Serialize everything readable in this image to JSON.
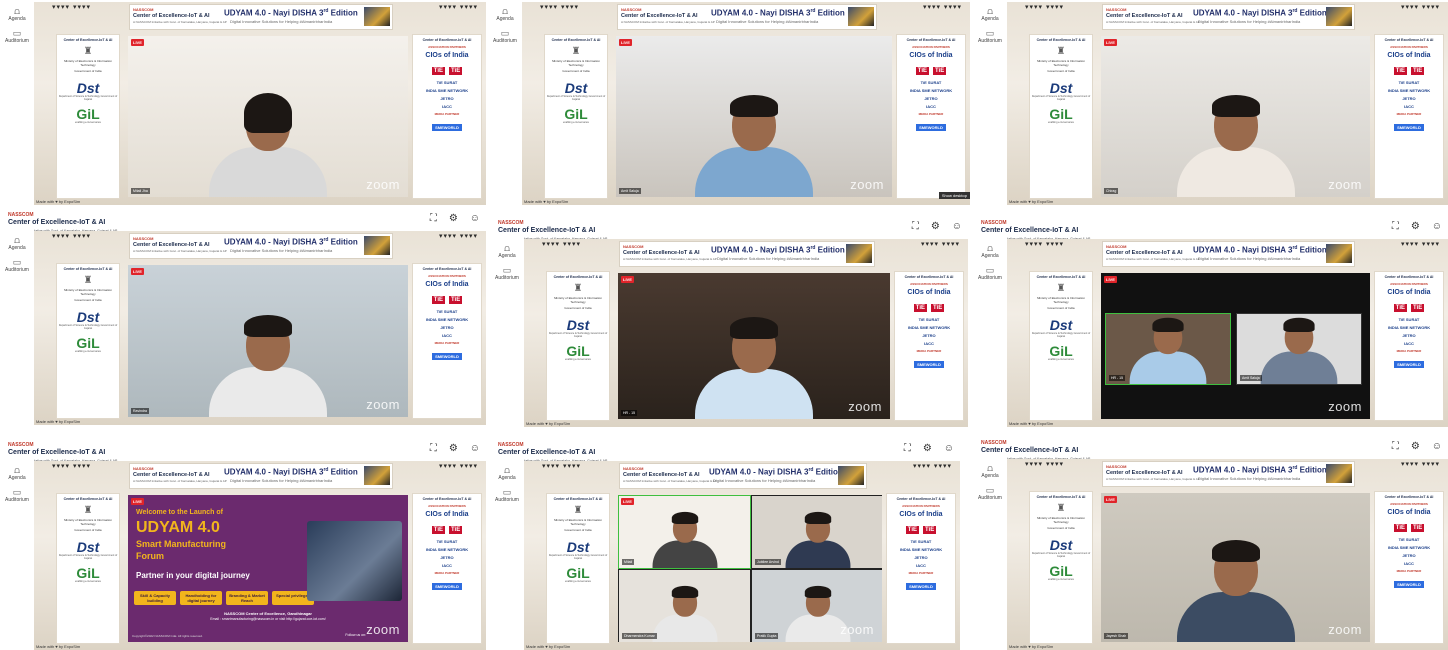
{
  "colors": {
    "brand_red": "#c0392b",
    "live_red": "#e0242a",
    "title_blue": "#23306b",
    "promo_purple": "#6b2a6e",
    "promo_yellow": "#f2b51c"
  },
  "app": {
    "brand_small": "NASSCOM",
    "brand_name": "Center of Excellence-IoT & AI",
    "brand_tag": "A NASSCOM Initiative with Govt. of Karnataka, Haryana, Gujarat & AP",
    "icons": [
      "fullscreen-icon",
      "gear-icon",
      "profile-icon"
    ]
  },
  "sidebar": {
    "items": [
      {
        "label": "Agenda",
        "icon": "podium-icon"
      },
      {
        "label": "Auditorium",
        "icon": "screen-icon"
      }
    ]
  },
  "stage": {
    "banner": {
      "nasscom": "NASSCOM",
      "coe": "Center of Excellence-IoT & AI",
      "coe_tag": "A NASSCOM Initiative with Govt. of Karnataka, Haryana, Gujarat & AP",
      "title": "UDYAM 4.0 - Nayi DISHA 3",
      "title_sup": "rd",
      "title_suffix": " Edition",
      "subtitle": "Digital Innovative Solutions for Helping #AtmanirbharIndia"
    },
    "left_panel": {
      "header": "Center of Excellence-IoT & AI",
      "ministry": "Ministry of Electronics & Information Technology",
      "ministry_sub": "Government of India",
      "dst": "Dst",
      "dst_sub": "Department of Science & Technology Government of Gujarat",
      "gil": "GiL",
      "gil_sub": "enabling e-Governance"
    },
    "right_panel": {
      "header": "Center of Excellence-IoT & AI",
      "association": "ASSOCIATION PARTNERS",
      "cios": "CIOs of India",
      "tie1": "TiE",
      "tie2": "TiE",
      "tie_surat": "TiE SURAT",
      "india_sme": "INDIA SME NETWORK",
      "jetro": "JETRO",
      "iacc": "IACC",
      "media": "MEDIA PARTNER",
      "smeworld": "SMEWORLD"
    },
    "made_with": "Made with ♥ by ExpoSim",
    "live": "LIVE",
    "zoom": "zoom",
    "show_desktop": "Show desktop"
  },
  "panels": [
    {
      "name_tag": "Mitali Jha",
      "speaker": "woman"
    },
    {
      "name_tag": "Amit Saluja",
      "speaker": "man"
    },
    {
      "name_tag": "Chirag",
      "speaker": "man"
    },
    {
      "name_tag": "Ravindra",
      "speaker": "man"
    },
    {
      "name_tag": "HR - 15",
      "speaker": "man"
    },
    {
      "name_tag": "HR - 15",
      "name_tag_2": "Amit Saluja",
      "speaker": "two"
    },
    {
      "name_tag": "",
      "speaker": "promo"
    },
    {
      "name_tags": [
        "Mitali",
        "Jubilee Arvind",
        "Dharmendra Kumar",
        "Pratik Gupta"
      ],
      "speaker": "grid"
    },
    {
      "name_tag": "Jayesh Shah",
      "speaker": "man"
    }
  ],
  "promo": {
    "welcome": "Welcome to the Launch of",
    "udyam": "UDYAM 4.0",
    "smart": "Smart Manufacturing",
    "forum": "Forum",
    "partner": "Partner in your digital journey",
    "pills": [
      "Skill & Capacity building",
      "Handholding for digital journey",
      "Branding & Market Reach",
      "Special privileges"
    ],
    "org": "NASSCOM Center of Excellence, Gandhinagar",
    "email": "Email : smartmanufacturing@nasscom.in  or visit http://gujarat.coe-iot.com/",
    "follow": "Follow us on:",
    "copyright": "Copyright©2022 NASSCOM CoE. All rights reserved."
  }
}
